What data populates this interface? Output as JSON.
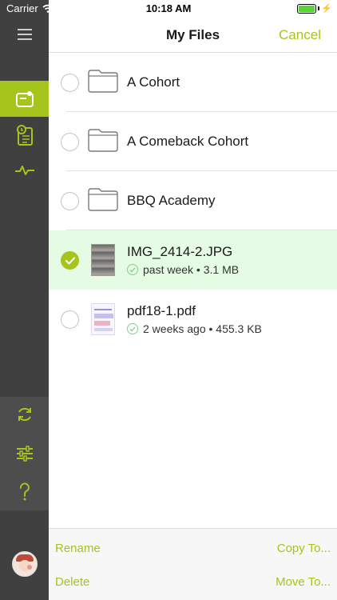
{
  "status_bar": {
    "carrier": "Carrier",
    "time": "10:18 AM",
    "battery_level": 1.0
  },
  "sidebar": {
    "items": [
      {
        "name": "menu",
        "icon": "hamburger-menu-icon"
      },
      {
        "name": "files",
        "icon": "file-box-icon",
        "active": true
      },
      {
        "name": "schedule",
        "icon": "clipboard-clock-icon"
      },
      {
        "name": "activity",
        "icon": "pulse-icon"
      },
      {
        "name": "sync",
        "icon": "refresh-icon"
      },
      {
        "name": "settings",
        "icon": "sliders-icon"
      },
      {
        "name": "help",
        "icon": "question-icon"
      },
      {
        "name": "profile",
        "icon": "avatar"
      }
    ]
  },
  "header": {
    "title": "My Files",
    "cancel_label": "Cancel"
  },
  "files": [
    {
      "name": "A Cohort",
      "type": "folder",
      "selected": false
    },
    {
      "name": "A Comeback Cohort",
      "type": "folder",
      "selected": false
    },
    {
      "name": "BBQ Academy",
      "type": "folder",
      "selected": false
    },
    {
      "name": "IMG_2414-2.JPG",
      "type": "image",
      "meta": "past week • 3.1 MB",
      "selected": true
    },
    {
      "name": "pdf18-1.pdf",
      "type": "pdf",
      "meta": "2 weeks ago • 455.3 KB",
      "selected": false
    }
  ],
  "toolbar": {
    "rename_label": "Rename",
    "copy_label": "Copy To...",
    "delete_label": "Delete",
    "move_label": "Move To..."
  },
  "colors": {
    "accent": "#a5c41c",
    "sidebar_bg": "#404040",
    "selected_row_bg": "#e5fbe3"
  }
}
